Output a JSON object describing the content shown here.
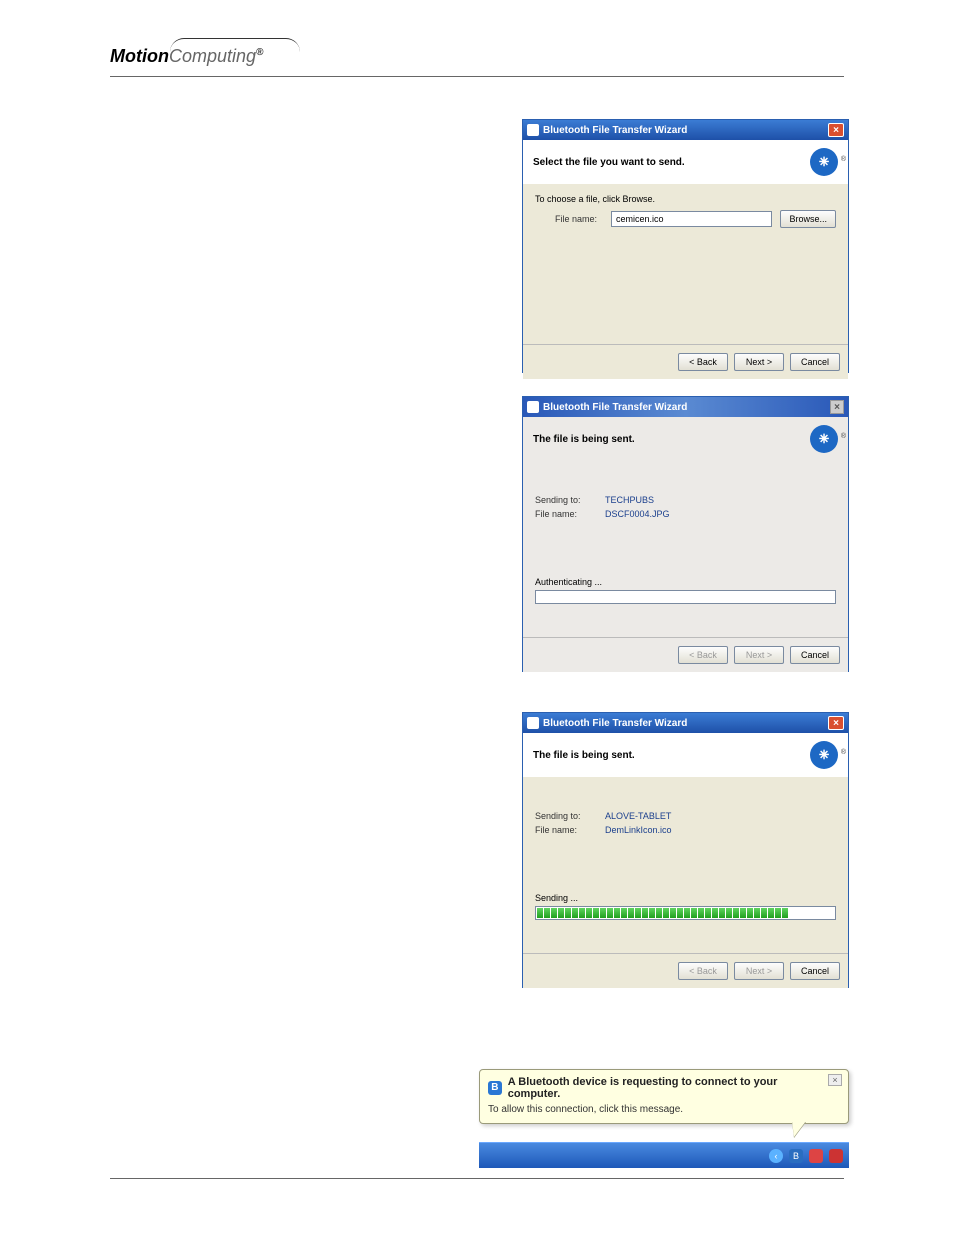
{
  "brand": {
    "motion": "Motion",
    "computing": "Computing"
  },
  "win1": {
    "title": "Bluetooth File Transfer Wizard",
    "subtitle": "Select the file you want to send.",
    "hint": "To choose a file, click Browse.",
    "filename_label": "File name:",
    "filename_value": "cemicen.ico",
    "browse": "Browse...",
    "back": "< Back",
    "next": "Next >",
    "cancel": "Cancel"
  },
  "win2": {
    "title": "Bluetooth File Transfer Wizard",
    "subtitle": "The file is being sent.",
    "sending_to_label": "Sending to:",
    "sending_to_value": "TECHPUBS",
    "filename_label": "File name:",
    "filename_value": "DSCF0004.JPG",
    "status": "Authenticating ...",
    "back": "< Back",
    "next": "Next >",
    "cancel": "Cancel"
  },
  "win3": {
    "title": "Bluetooth File Transfer Wizard",
    "subtitle": "The file is being sent.",
    "sending_to_label": "Sending to:",
    "sending_to_value": "ALOVE-TABLET",
    "filename_label": "File name:",
    "filename_value": "DemLinkIcon.ico",
    "status": "Sending ...",
    "back": "< Back",
    "next": "Next >",
    "cancel": "Cancel"
  },
  "balloon": {
    "title": "A Bluetooth device is requesting to connect to your computer.",
    "message": "To allow this connection, click this message."
  }
}
